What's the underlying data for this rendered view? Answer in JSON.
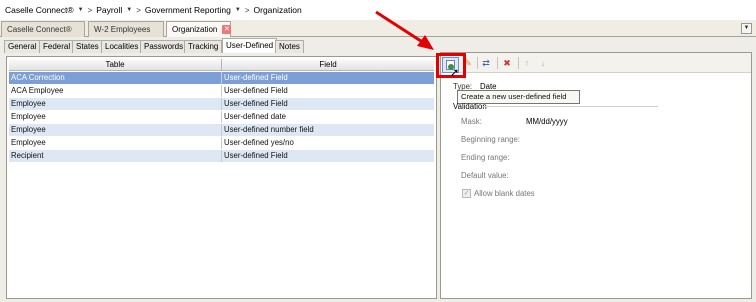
{
  "breadcrumb": {
    "items": [
      "Caselle Connect®",
      "Payroll",
      "Government Reporting",
      "Organization"
    ],
    "separators": [
      ">",
      ">",
      ">"
    ]
  },
  "app_tabs": [
    {
      "label": "Caselle Connect®",
      "active": false
    },
    {
      "label": "W-2 Employees",
      "active": false
    },
    {
      "label": "Organization",
      "active": true
    }
  ],
  "sub_tabs": [
    {
      "label": "General"
    },
    {
      "label": "Federal"
    },
    {
      "label": "States"
    },
    {
      "label": "Localities"
    },
    {
      "label": "Passwords"
    },
    {
      "label": "Tracking"
    },
    {
      "label": "User-Defined",
      "active": true
    },
    {
      "label": "Notes"
    }
  ],
  "table": {
    "columns": [
      "Table",
      "Field"
    ],
    "rows": [
      {
        "table": "ACA Correction",
        "field": "User-defined Field",
        "selected": true
      },
      {
        "table": "ACA Employee",
        "field": "User-defined Field"
      },
      {
        "table": "Employee",
        "field": "User-defined Field"
      },
      {
        "table": "Employee",
        "field": "User-defined date"
      },
      {
        "table": "Employee",
        "field": "User-defined number field"
      },
      {
        "table": "Employee",
        "field": "User-defined yes/no"
      },
      {
        "table": "Recipient",
        "field": "User-defined Field"
      }
    ]
  },
  "toolbar": {
    "tooltip": "Create a new user-defined field",
    "icons": [
      "add-field-icon",
      "edit-icon",
      "copy-icon",
      "delete-icon",
      "move-up-icon",
      "move-down-icon"
    ]
  },
  "details": {
    "type_label": "Type:",
    "type_value": "Date",
    "validation_label": "Validation",
    "mask_label": "Mask:",
    "mask_value": "MM/dd/yyyy",
    "beginning_range_label": "Beginning range:",
    "ending_range_label": "Ending range:",
    "default_value_label": "Default value:",
    "allow_blank_label": "Allow blank dates",
    "allow_blank_checked": true
  },
  "colors": {
    "selected_row": "#7b9fd6",
    "alt_row": "#dde8f4",
    "highlight": "#e40000"
  }
}
